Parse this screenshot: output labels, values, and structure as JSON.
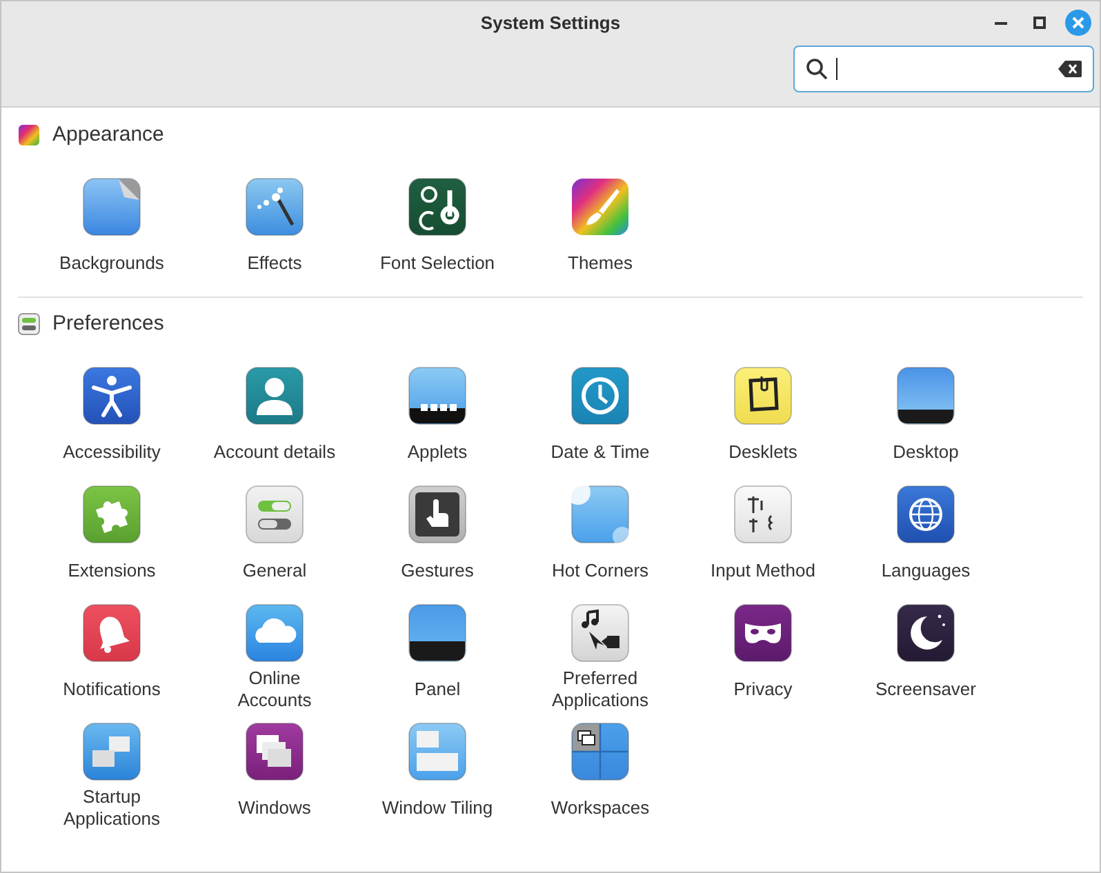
{
  "window": {
    "title": "System Settings"
  },
  "sections": [
    {
      "title": "Appearance",
      "kind": "appearance",
      "items": [
        {
          "label": "Backgrounds",
          "kind": "backgrounds"
        },
        {
          "label": "Effects",
          "kind": "effects"
        },
        {
          "label": "Font Selection",
          "kind": "fonts"
        },
        {
          "label": "Themes",
          "kind": "themes"
        }
      ]
    },
    {
      "title": "Preferences",
      "kind": "preferences",
      "items": [
        {
          "label": "Accessibility",
          "kind": "accessibility"
        },
        {
          "label": "Account details",
          "kind": "account"
        },
        {
          "label": "Applets",
          "kind": "applets"
        },
        {
          "label": "Date & Time",
          "kind": "datetime"
        },
        {
          "label": "Desklets",
          "kind": "desklets"
        },
        {
          "label": "Desktop",
          "kind": "desktop"
        },
        {
          "label": "Extensions",
          "kind": "extensions"
        },
        {
          "label": "General",
          "kind": "general"
        },
        {
          "label": "Gestures",
          "kind": "gestures"
        },
        {
          "label": "Hot Corners",
          "kind": "hotcorners"
        },
        {
          "label": "Input Method",
          "kind": "inputmethod"
        },
        {
          "label": "Languages",
          "kind": "languages"
        },
        {
          "label": "Notifications",
          "kind": "notifications"
        },
        {
          "label": "Online Accounts",
          "kind": "online"
        },
        {
          "label": "Panel",
          "kind": "panel"
        },
        {
          "label": "Preferred Applications",
          "kind": "preferred"
        },
        {
          "label": "Privacy",
          "kind": "privacy"
        },
        {
          "label": "Screensaver",
          "kind": "screensaver"
        },
        {
          "label": "Startup Applications",
          "kind": "startup"
        },
        {
          "label": "Windows",
          "kind": "windows"
        },
        {
          "label": "Window Tiling",
          "kind": "tiling"
        },
        {
          "label": "Workspaces",
          "kind": "workspaces"
        }
      ]
    }
  ]
}
